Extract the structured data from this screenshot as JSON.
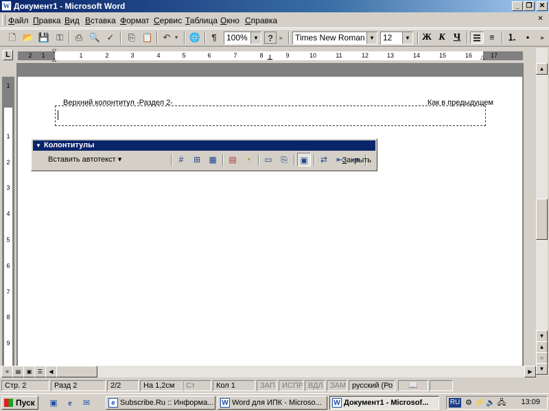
{
  "window": {
    "title": "Документ1 - Microsoft Word",
    "app_icon": "W",
    "controls": [
      "_",
      "❐",
      "✕"
    ]
  },
  "menu": {
    "items": [
      "Файл",
      "Правка",
      "Вид",
      "Вставка",
      "Формат",
      "Сервис",
      "Таблица",
      "Окно",
      "Справка"
    ],
    "mdi_close": "✕"
  },
  "toolbar": {
    "zoom": "100%",
    "font": "Times New Roman",
    "size": "12",
    "bold": "Ж",
    "italic": "К",
    "underline": "Ч",
    "pilcrow": "¶",
    "help": "?"
  },
  "ruler": {
    "numbers": [
      "2",
      "1",
      "1",
      "2",
      "3",
      "4",
      "5",
      "6",
      "7",
      "8",
      "9",
      "10",
      "11",
      "12",
      "13",
      "14",
      "15",
      "16",
      "17"
    ],
    "vertical_numbers": [
      "1",
      "1",
      "2",
      "3",
      "4",
      "5",
      "6",
      "7",
      "8",
      "9"
    ],
    "box": "L"
  },
  "header": {
    "label": "Верхний колонтитул -Раздел 2-",
    "same_as_previous": "Как в предыдущем"
  },
  "hf_toolbar": {
    "title": "Колонтитулы",
    "insert_autotext": "Вставить автотекст ▾",
    "close": "Закрыть",
    "buttons": [
      "#",
      "⊞",
      "▦",
      "▤",
      "◔",
      "▭",
      "⎘",
      "▣",
      "⇄",
      "⇤",
      "⇥"
    ]
  },
  "statusbar": {
    "page": "Стр. 2",
    "section": "Разд 2",
    "pages": "2/2",
    "at": "На 1,2см",
    "line": "Ст",
    "col": "Кол 1",
    "rec": "ЗАП",
    "trk": "ИСПР",
    "ext": "ВДЛ",
    "ovr": "ЗАМ",
    "language": "русский (Ро"
  },
  "taskbar": {
    "start": "Пуск",
    "tasks": [
      {
        "label": "Subscribe.Ru :: Информа...",
        "icon": "e"
      },
      {
        "label": "Word для ИПК - Microso...",
        "icon": "W"
      },
      {
        "label": "Документ1 - Microsof...",
        "icon": "W"
      }
    ],
    "lang": "RU",
    "clock": "13:09"
  }
}
